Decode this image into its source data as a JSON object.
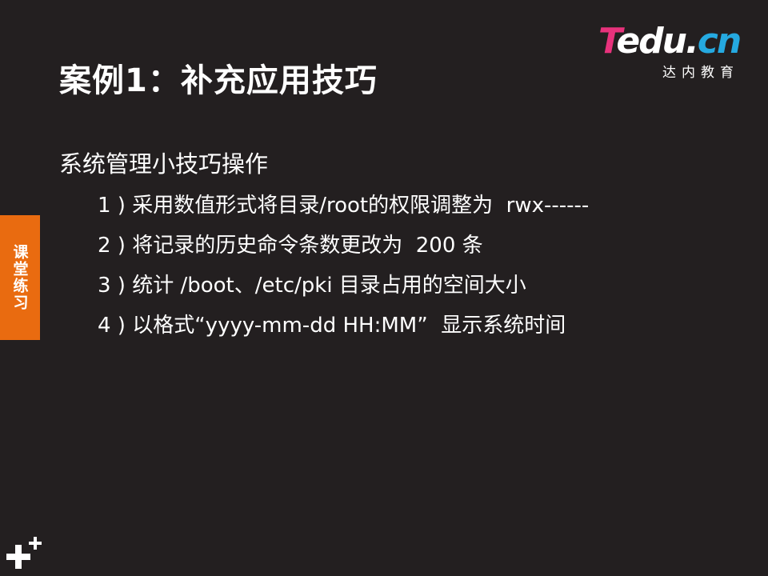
{
  "slide": {
    "title": "案例1：补充应用技巧",
    "heading": "系统管理小技巧操作",
    "tasks": [
      {
        "text": "1 ) 采用数值形式将目录/root的权限调整为  rwx------"
      },
      {
        "text": "2 ) 将记录的历史命令条数更改为  200 条"
      },
      {
        "text": "3 ) 统计 /boot、/etc/pki 目录占用的空间大小"
      },
      {
        "text": "4 ) 以格式“yyyy-mm-dd HH:MM”  显示系统时间"
      }
    ]
  },
  "logo": {
    "t": "T",
    "edu": "edu.",
    "cn": "cn",
    "subtitle": "达内教育"
  },
  "side_tab": {
    "label": "课堂练习"
  },
  "icons": {
    "corner": "plus-icon"
  },
  "colors": {
    "background": "#231f20",
    "accent_orange": "#e96b10",
    "logo_pink": "#e8327c",
    "logo_blue": "#25a9e0"
  }
}
